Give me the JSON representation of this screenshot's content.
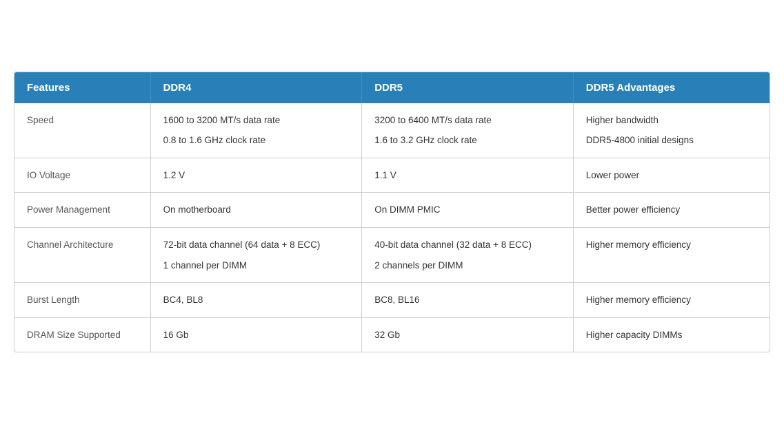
{
  "header": {
    "col1": "Features",
    "col2": "DDR4",
    "col3": "DDR5",
    "col4": "DDR5 Advantages"
  },
  "rows": [
    {
      "feature": "Speed",
      "ddr4": [
        "1600 to 3200 MT/s data rate",
        "0.8 to 1.6 GHz clock rate"
      ],
      "ddr5": [
        "3200 to 6400 MT/s data rate",
        "1.6 to 3.2 GHz clock rate"
      ],
      "advantage": [
        "Higher bandwidth",
        "DDR5-4800 initial designs"
      ]
    },
    {
      "feature": "IO Voltage",
      "ddr4": [
        "1.2 V"
      ],
      "ddr5": [
        "1.1 V"
      ],
      "advantage": [
        "Lower power"
      ]
    },
    {
      "feature": "Power Management",
      "ddr4": [
        "On motherboard"
      ],
      "ddr5": [
        "On DIMM PMIC"
      ],
      "advantage": [
        "Better power efficiency"
      ]
    },
    {
      "feature": "Channel Architecture",
      "ddr4": [
        "72-bit data channel (64 data + 8 ECC)",
        "1 channel per DIMM"
      ],
      "ddr5": [
        "40-bit data channel (32 data + 8 ECC)",
        "2 channels per DIMM"
      ],
      "advantage": [
        "Higher memory efficiency"
      ]
    },
    {
      "feature": "Burst Length",
      "ddr4": [
        "BC4, BL8"
      ],
      "ddr5": [
        "BC8, BL16"
      ],
      "advantage": [
        "Higher memory efficiency"
      ]
    },
    {
      "feature": "DRAM Size Supported",
      "ddr4": [
        "16 Gb"
      ],
      "ddr5": [
        "32 Gb"
      ],
      "advantage": [
        "Higher capacity DIMMs"
      ]
    }
  ]
}
